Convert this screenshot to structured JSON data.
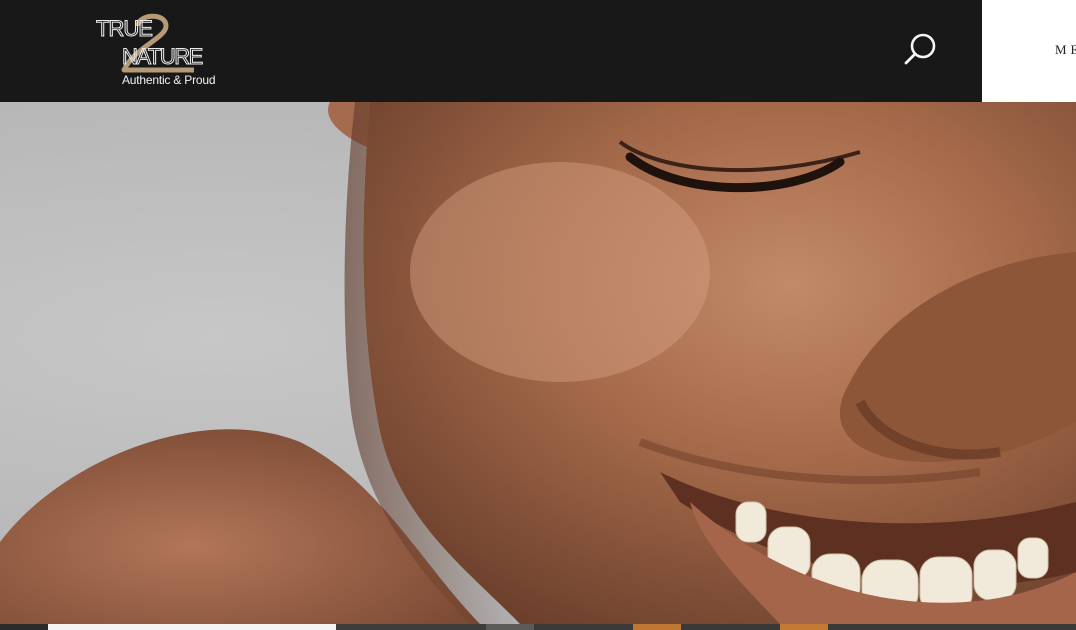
{
  "header": {
    "logo": {
      "line1": "TRUE",
      "line2": "NATURE",
      "tagline": "Authentic & Proud",
      "colors": {
        "gold": "#b59a78",
        "white": "#ececec"
      }
    },
    "search_icon": "search-icon",
    "menu_label": "MENU"
  },
  "hero": {
    "image": "smiling-woman-closeup",
    "colors": {
      "background": "#bdbdbd",
      "skin": "#9a6242"
    }
  },
  "bottom_strip": {
    "colors": [
      "#2b2b2b",
      "#f4f4f4",
      "#3f3d3b",
      "#5c5a58",
      "#3b3a38",
      "#c07733",
      "#3a3937",
      "#c37a32",
      "#3a3a39"
    ]
  }
}
